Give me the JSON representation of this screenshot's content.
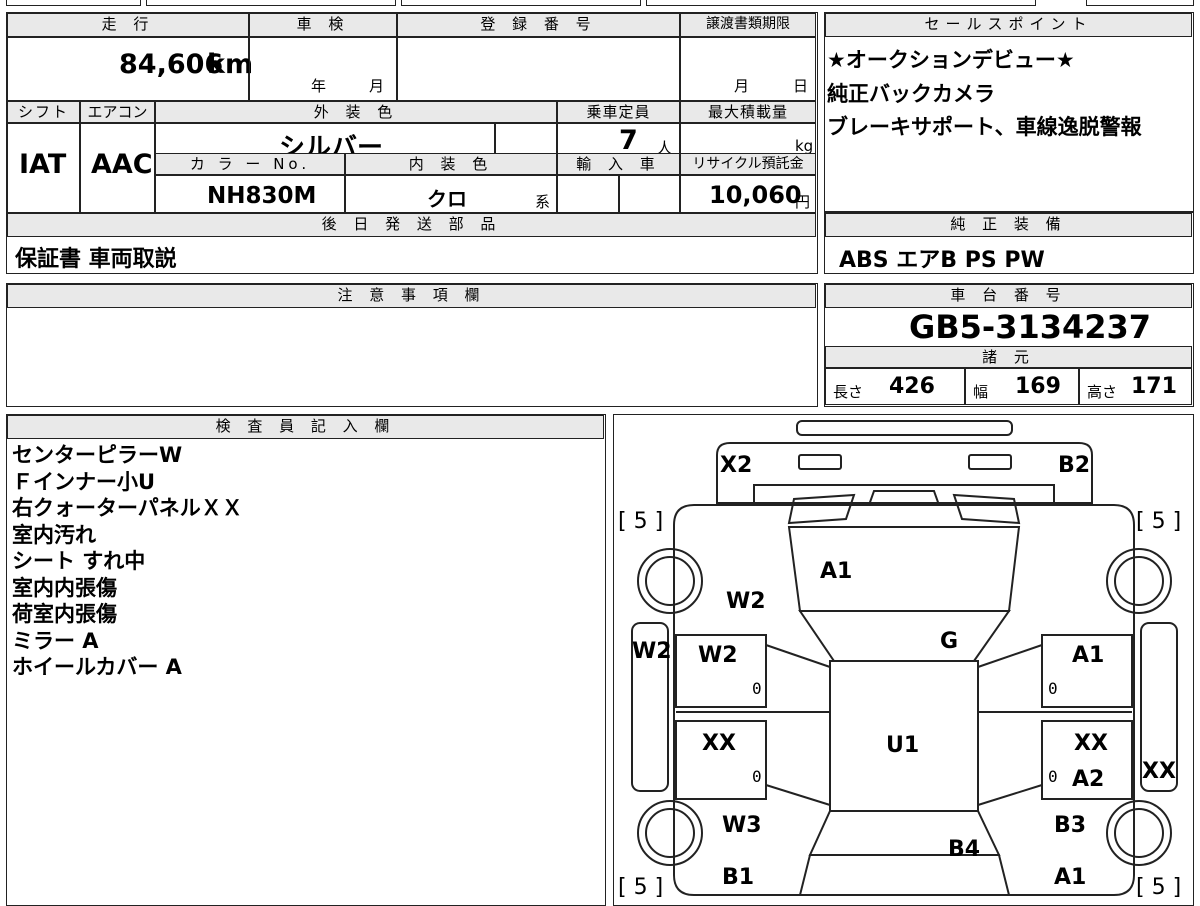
{
  "headers": {
    "mileage": "走 行",
    "inspection": "車 検",
    "registration": "登 録 番 号",
    "transfer_deadline": "譲渡書類期限",
    "sales_points": "セールスポイント",
    "shift": "シフト",
    "aircon": "エアコン",
    "exterior_color": "外 装 色",
    "capacity": "乗車定員",
    "max_load": "最大積載量",
    "color_no": "カ ラ ー No.",
    "interior_color": "内 装 色",
    "import": "輸 入 車",
    "recycle": "リサイクル預託金",
    "later_parts": "後 日 発 送 部 品",
    "standard_equipment": "純 正 装 備",
    "notes": "注 意 事 項 欄",
    "chassis_no": "車 台 番 号",
    "specs": "諸 元",
    "inspector": "検 査 員 記 入 欄"
  },
  "values": {
    "mileage": "84,606",
    "mileage_unit": "km",
    "inspection_year": "年",
    "inspection_month": "月",
    "transfer_month": "月",
    "transfer_day": "日",
    "shift": "IAT",
    "aircon": "AAC",
    "exterior_color": "シルバー",
    "capacity": "7",
    "capacity_unit": "人",
    "max_load_unit": "kg",
    "color_no": "NH830M",
    "interior_color": "クロ",
    "interior_suffix": "系",
    "recycle": "10,060",
    "recycle_unit": "円",
    "later_parts": "保証書 車両取説",
    "standard_equipment": "ABS エアB PS PW",
    "chassis_no": "GB5-3134237",
    "length_label": "長さ",
    "length": "426",
    "width_label": "幅",
    "width": "169",
    "height_label": "高さ",
    "height": "171"
  },
  "sales_points": [
    "★オークションデビュー★",
    "純正バックカメラ",
    "ブレーキサポート、車線逸脱警報"
  ],
  "inspector_notes": [
    "センターピラーW",
    "Ｆインナー小U",
    "右クォーターパネルＸＸ",
    "室内汚れ",
    "シート すれ中",
    "室内内張傷",
    "荷室内張傷",
    "ミラー A",
    "ホイールカバー A"
  ],
  "diagram": {
    "x2": "X2",
    "b2": "B2",
    "tire_fl": "[ 5 ]",
    "tire_fr": "[ 5 ]",
    "tire_rl": "[ 5 ]",
    "tire_rr": "[ 5 ]",
    "a1_hood": "A1",
    "w2_front": "W2",
    "g_roof": "G",
    "w2_side_left": "W2",
    "w2_door_left": "W2",
    "a1_door_right": "A1",
    "xx_left": "XX",
    "u1": "U1",
    "xx_right": "XX",
    "a2_right": "A2",
    "xx_side_right": "XX",
    "w3": "W3",
    "b3": "B3",
    "b4": "B4",
    "b1": "B1",
    "a1_rear_right": "A1",
    "zero": "0"
  }
}
